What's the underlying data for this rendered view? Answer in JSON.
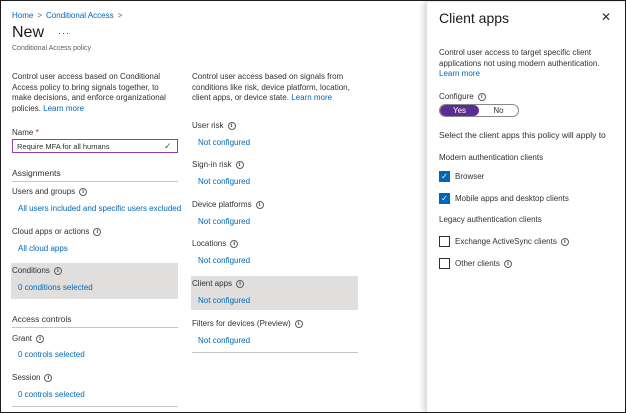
{
  "breadcrumb": {
    "home": "Home",
    "current": "Conditional Access",
    "sep": ">"
  },
  "page": {
    "title": "New",
    "more": "···",
    "subtitle": "Conditional Access policy"
  },
  "left_desc": {
    "text": "Control user access based on Conditional Access policy to bring signals together, to make decisions, and enforce organizational policies.",
    "learn_more": "Learn more"
  },
  "right_desc": {
    "text": "Control user access based on signals from conditions like risk, device platform, location, client apps, or device state.",
    "learn_more": "Learn more"
  },
  "name": {
    "label": "Name",
    "required": "*",
    "value": "Require MFA for all humans"
  },
  "assignments": {
    "heading": "Assignments",
    "users": {
      "label": "Users and groups",
      "value": "All users included and specific users excluded"
    },
    "cloud": {
      "label": "Cloud apps or actions",
      "value": "All cloud apps"
    },
    "conditions": {
      "label": "Conditions",
      "value": "0 conditions selected"
    }
  },
  "access": {
    "heading": "Access controls",
    "grant": {
      "label": "Grant",
      "value": "0 controls selected"
    },
    "session": {
      "label": "Session",
      "value": "0 controls selected"
    }
  },
  "conditions": [
    {
      "label": "User risk",
      "value": "Not configured"
    },
    {
      "label": "Sign-in risk",
      "value": "Not configured"
    },
    {
      "label": "Device platforms",
      "value": "Not configured"
    },
    {
      "label": "Locations",
      "value": "Not configured"
    },
    {
      "label": "Client apps",
      "value": "Not configured"
    },
    {
      "label": "Filters for devices (Preview)",
      "value": "Not configured"
    }
  ],
  "panel": {
    "title": "Client apps",
    "close": "✕",
    "desc": "Control user access to target specific client applications not using modern authentication.",
    "learn_more": "Learn more",
    "configure_label": "Configure",
    "yes": "Yes",
    "no": "No",
    "select_text": "Select the client apps this policy will apply to",
    "modern_heading": "Modern authentication clients",
    "browser": "Browser",
    "mobile": "Mobile apps and desktop clients",
    "legacy_heading": "Legacy authentication clients",
    "eas": "Exchange ActiveSync clients",
    "other": "Other clients"
  },
  "colors": {
    "accent": "#0067b8",
    "toggle_on": "#5c2d91",
    "valid": "#107c10"
  }
}
